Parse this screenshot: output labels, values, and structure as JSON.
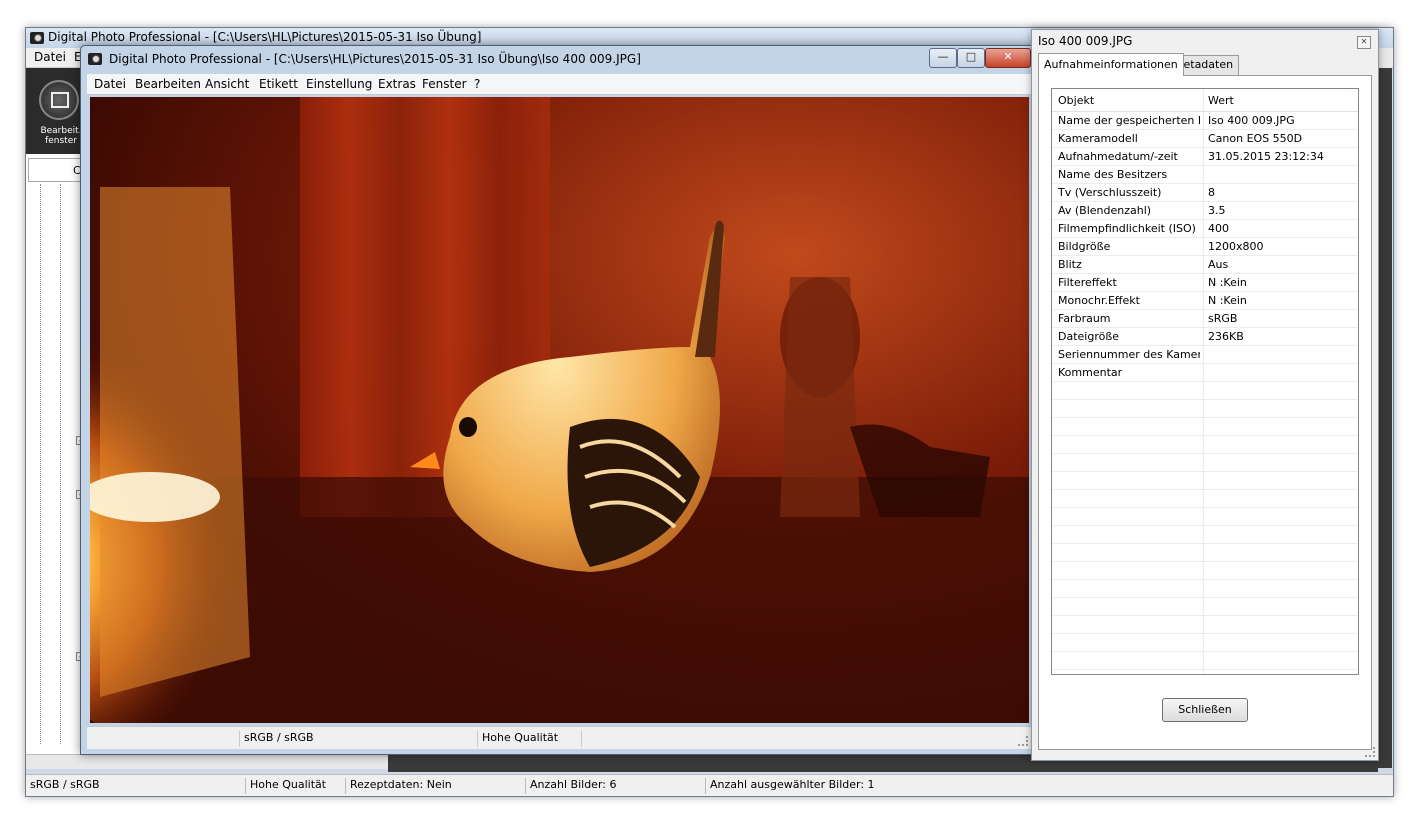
{
  "main_window": {
    "title": "Digital Photo Professional - [C:\\Users\\HL\\Pictures\\2015-05-31 Iso Übung]",
    "menu": [
      "Datei",
      "E"
    ],
    "tool_label_1": "Bearbeit.",
    "tool_label_2": "fenster",
    "panel_letter": "C",
    "status": {
      "color_space": "sRGB / sRGB",
      "quality": "Hohe Qualität",
      "recipe": "Rezeptdaten: Nein",
      "count": "Anzahl Bilder: 6",
      "selected": "Anzahl ausgewählter Bilder: 1"
    }
  },
  "edit_window": {
    "title": "Digital Photo Professional - [C:\\Users\\HL\\Pictures\\2015-05-31 Iso Übung\\Iso 400  009.JPG]",
    "menu": [
      "Datei",
      "Bearbeiten",
      "Ansicht",
      "Etikett",
      "Einstellung",
      "Extras",
      "Fenster",
      "?"
    ],
    "status": {
      "color_space": "sRGB / sRGB",
      "quality": "Hohe Qualität"
    }
  },
  "info_window": {
    "title": "Iso 400  009.JPG",
    "tabs": [
      "Aufnahmeinformationen",
      "Metadaten"
    ],
    "headers": [
      "Objekt",
      "Wert"
    ],
    "rows": [
      [
        "Name der gespeicherten D...",
        "Iso 400  009.JPG"
      ],
      [
        "Kameramodell",
        "Canon EOS 550D"
      ],
      [
        "Aufnahmedatum/-zeit",
        "31.05.2015 23:12:34"
      ],
      [
        "Name des Besitzers",
        ""
      ],
      [
        "Tv (Verschlusszeit)",
        "8"
      ],
      [
        "Av (Blendenzahl)",
        "3.5"
      ],
      [
        "Filmempfindlichkeit (ISO)",
        "400"
      ],
      [
        "Bildgröße",
        "1200x800"
      ],
      [
        "Blitz",
        "Aus"
      ],
      [
        "Filtereffekt",
        "N :Kein"
      ],
      [
        "Monochr.Effekt",
        "N :Kein"
      ],
      [
        "Farbraum",
        "sRGB"
      ],
      [
        "Dateigröße",
        "236KB"
      ],
      [
        "Seriennummer des Kamera...",
        ""
      ],
      [
        "Kommentar",
        ""
      ]
    ],
    "close_label": "Schließen"
  }
}
